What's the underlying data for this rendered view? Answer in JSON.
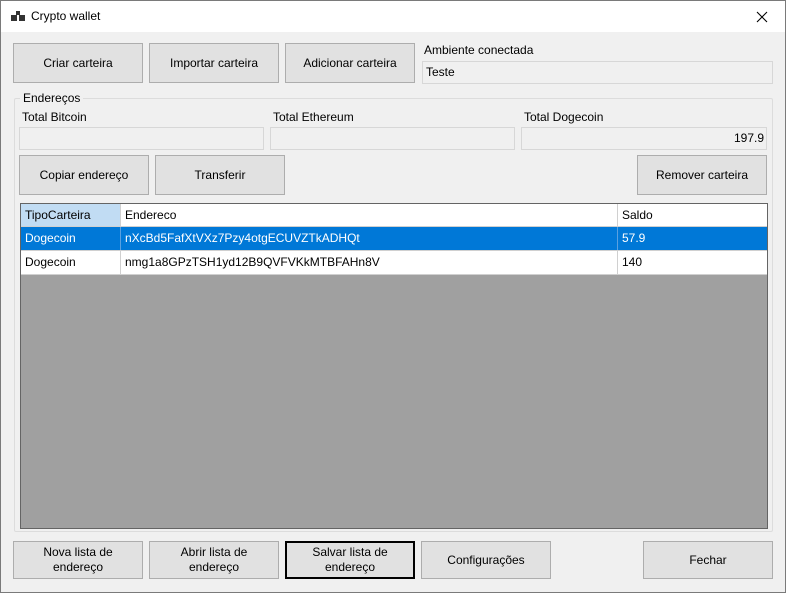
{
  "window": {
    "title": "Crypto wallet",
    "icon": "wallet-app-icon",
    "close_icon": "close-icon"
  },
  "top_buttons": {
    "criar": "Criar carteira",
    "importar": "Importar carteira",
    "adicionar": "Adicionar carteira"
  },
  "ambiente": {
    "label": "Ambiente conectada",
    "value": "Teste"
  },
  "enderecos_group": {
    "title": "Endereços",
    "total_bitcoin_label": "Total Bitcoin",
    "total_bitcoin_value": "",
    "total_ethereum_label": "Total Ethereum",
    "total_ethereum_value": "",
    "total_dogecoin_label": "Total Dogecoin",
    "total_dogecoin_value": "197.9",
    "copiar": "Copiar endereço",
    "transferir": "Transferir",
    "remover": "Remover carteira"
  },
  "table": {
    "columns": [
      "TipoCarteira",
      "Endereco",
      "Saldo"
    ],
    "rows": [
      {
        "tipo": "Dogecoin",
        "endereco": "nXcBd5FafXtVXz7Pzy4otgECUVZTkADHQt",
        "saldo": "57.9",
        "selected": true
      },
      {
        "tipo": "Dogecoin",
        "endereco": "nmg1a8GPzTSH1yd12B9QVFVKkMTBFAHn8V",
        "saldo": "140",
        "selected": false
      }
    ]
  },
  "bottom_buttons": {
    "nova": "Nova lista de endereço",
    "abrir": "Abrir lista de endereço",
    "salvar": "Salvar lista de endereço",
    "config": "Configurações",
    "fechar": "Fechar"
  },
  "colors": {
    "selection": "#0078d7",
    "header_selected": "#c1dcf3",
    "grid_background": "#a0a0a0"
  }
}
